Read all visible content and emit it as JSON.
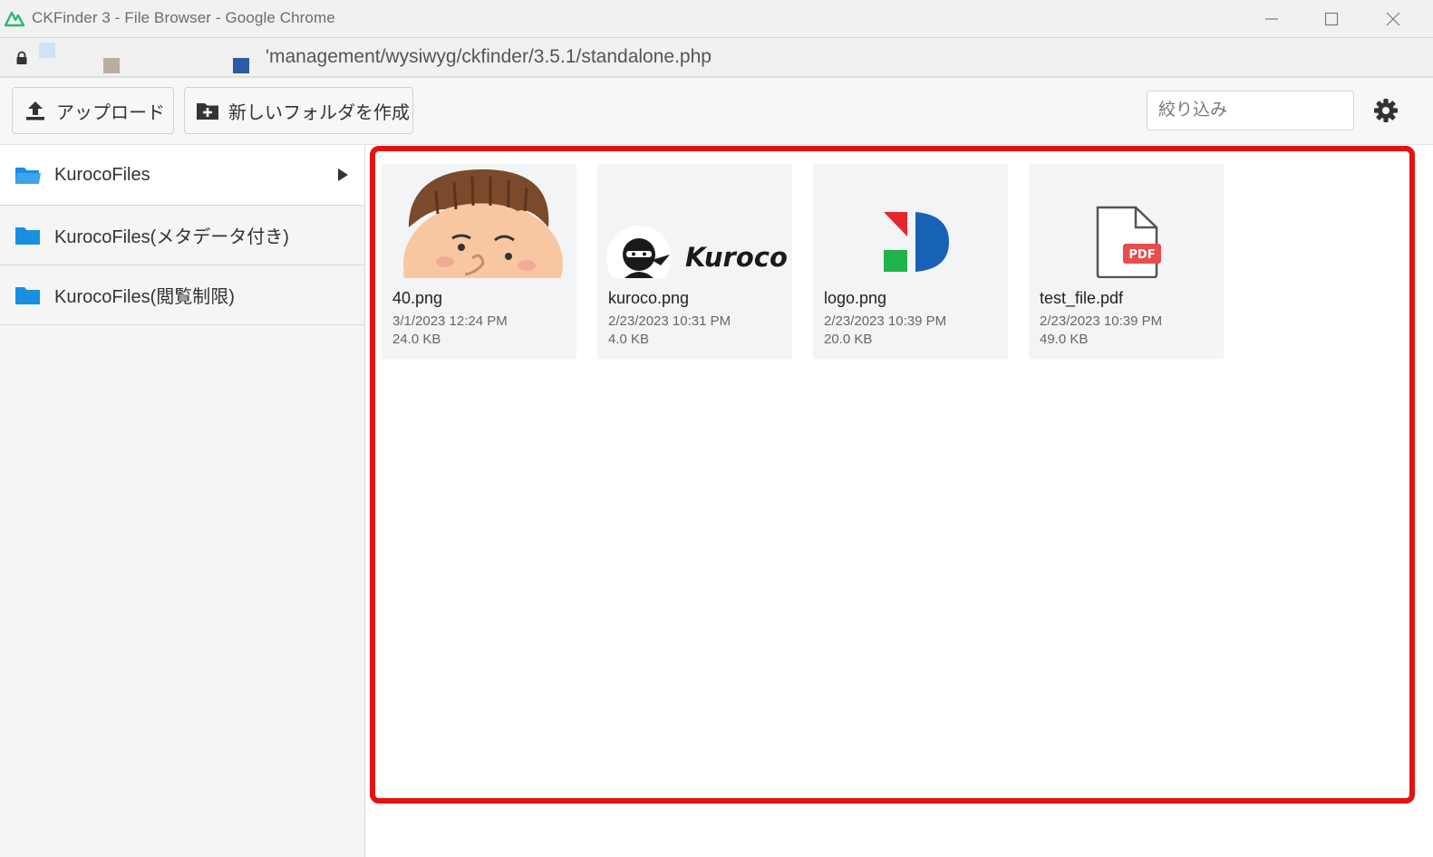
{
  "window": {
    "title": "CKFinder 3 - File Browser - Google Chrome",
    "url": "'management/wysiwyg/ckfinder/3.5.1/standalone.php"
  },
  "toolbar": {
    "upload_label": "アップロード",
    "new_folder_label": "新しいフォルダを作成",
    "filter_placeholder": "絞り込み"
  },
  "sidebar": {
    "items": [
      {
        "label": "KurocoFiles",
        "expandable": true,
        "active": true
      },
      {
        "label": "KurocoFiles(メタデータ付き)",
        "expandable": false,
        "active": false
      },
      {
        "label": "KurocoFiles(閲覧制限)",
        "expandable": false,
        "active": false
      }
    ]
  },
  "files": [
    {
      "name": "40.png",
      "date": "3/1/2023 12:24 PM",
      "size": "24.0 KB",
      "thumb": "face-illustration"
    },
    {
      "name": "kuroco.png",
      "date": "2/23/2023 10:31 PM",
      "size": "4.0 KB",
      "thumb": "kuroco-logo",
      "thumb_text": "Kuroco"
    },
    {
      "name": "logo.png",
      "date": "2/23/2023 10:39 PM",
      "size": "20.0 KB",
      "thumb": "colored-shapes-logo"
    },
    {
      "name": "test_file.pdf",
      "date": "2/23/2023 10:39 PM",
      "size": "49.0 KB",
      "thumb": "pdf-file-icon",
      "thumb_text": "PDF"
    }
  ],
  "colors": {
    "highlight": "#e41313",
    "folder": "#1a8fe0",
    "pdf_badge": "#e84c4c"
  }
}
